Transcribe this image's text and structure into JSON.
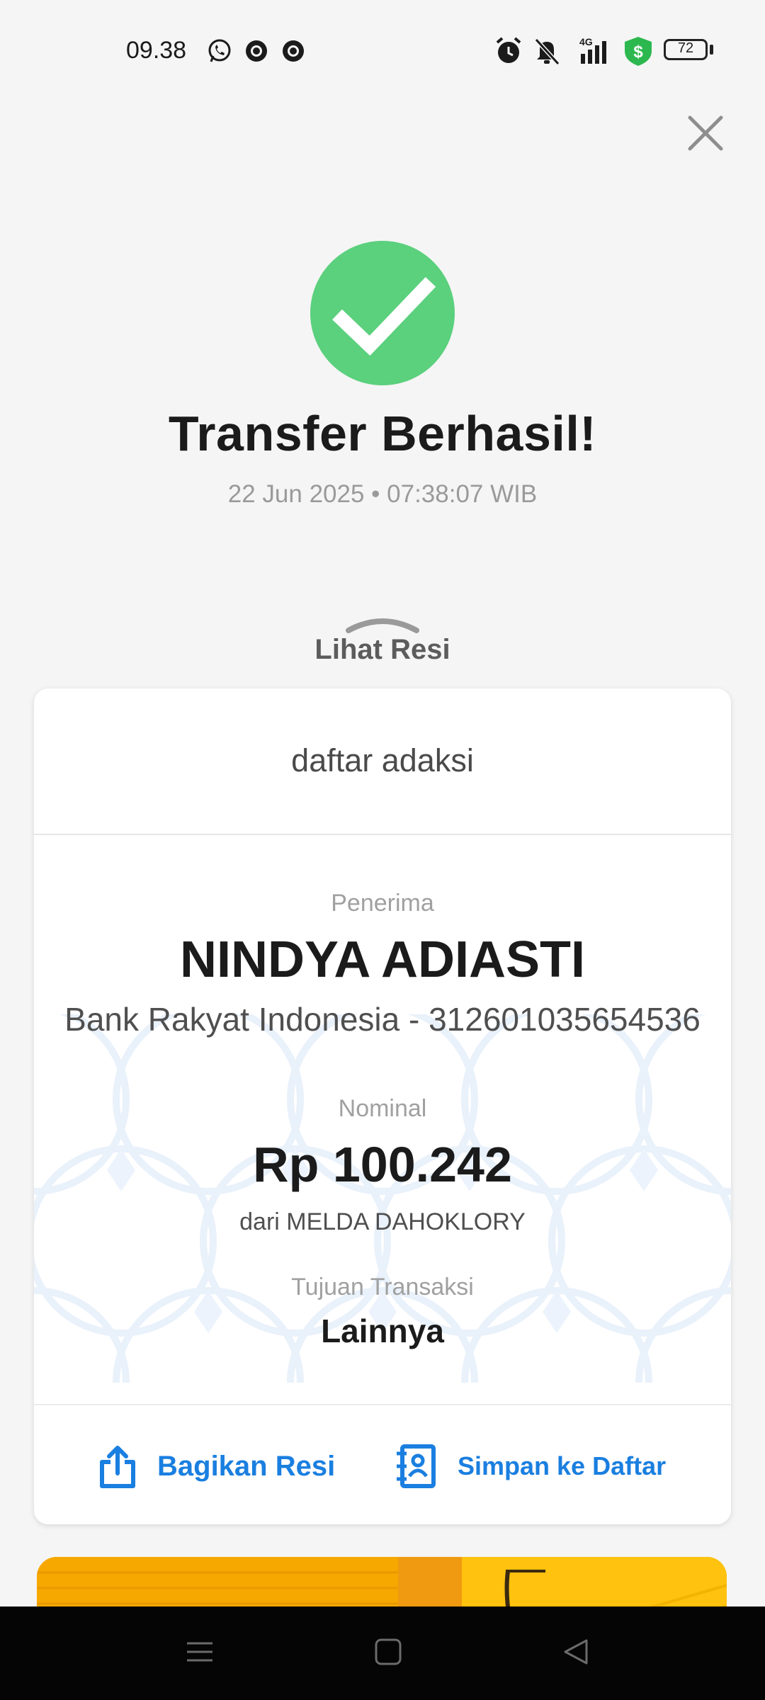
{
  "status_bar": {
    "time": "09.38",
    "battery_level": "72",
    "network": "4G",
    "icons": [
      "whatsapp-icon",
      "chrome-icon",
      "chrome-icon",
      "alarm-icon",
      "mute-icon",
      "signal-icon",
      "shield-dollar-icon",
      "battery-icon"
    ]
  },
  "header": {
    "close_icon": "close-icon"
  },
  "result": {
    "title": "Transfer Berhasil!",
    "datetime": "22 Jun 2025 • 07:38:07 WIB",
    "status_color": "#5bd07d"
  },
  "receipt": {
    "toggle_label": "Lihat Resi",
    "header_text": "daftar adaksi",
    "recipient_label": "Penerima",
    "recipient_name": "NINDYA ADIASTI",
    "recipient_bank": "Bank Rakyat Indonesia - 312601035654536",
    "amount_label": "Nominal",
    "amount": "Rp 100.242",
    "from": "dari MELDA DAHOKLORY",
    "purpose_label": "Tujuan Transaksi",
    "purpose": "Lainnya",
    "share_label": "Bagikan Resi",
    "save_label": "Simpan ke Daftar"
  },
  "colors": {
    "accent": "#1a7fe0",
    "success": "#5bd07d",
    "banner": "#f7a800"
  }
}
